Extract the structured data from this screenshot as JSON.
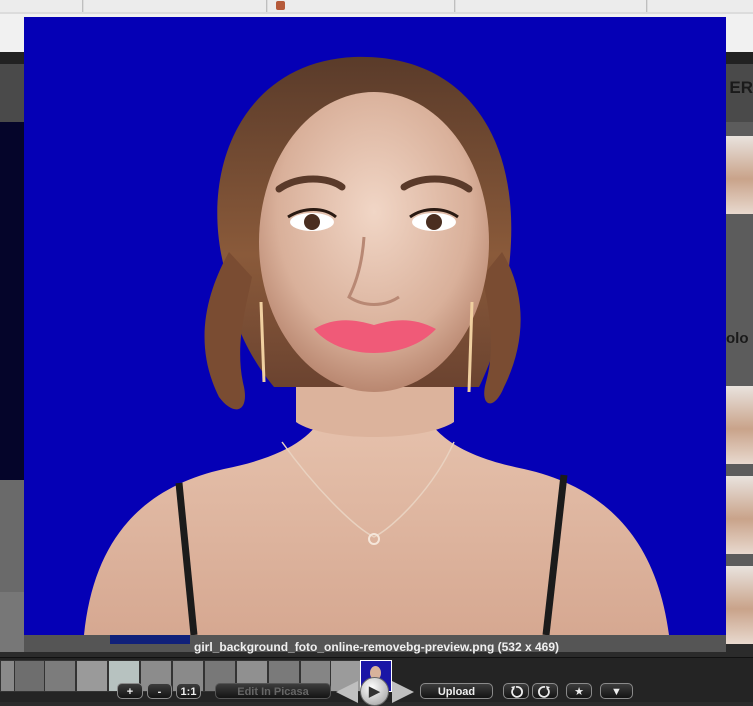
{
  "page": {
    "header_partial_text": "ER",
    "right_partial_text": "olo"
  },
  "lightbox": {
    "caption": "girl_background_foto_online-removebg-preview.png (532 x 469)",
    "background_color": "#0500b5"
  },
  "controls": {
    "zoom_in_label": "+",
    "zoom_out_label": "-",
    "actual_size_label": "1:1",
    "edit_label": "Edit In Picasa",
    "upload_label": "Upload",
    "rotate_left_icon": "rotate-left-icon",
    "rotate_right_icon": "rotate-right-icon",
    "star_icon": "star-icon",
    "more_icon": "chevron-down-icon",
    "play_icon": "play-icon"
  }
}
